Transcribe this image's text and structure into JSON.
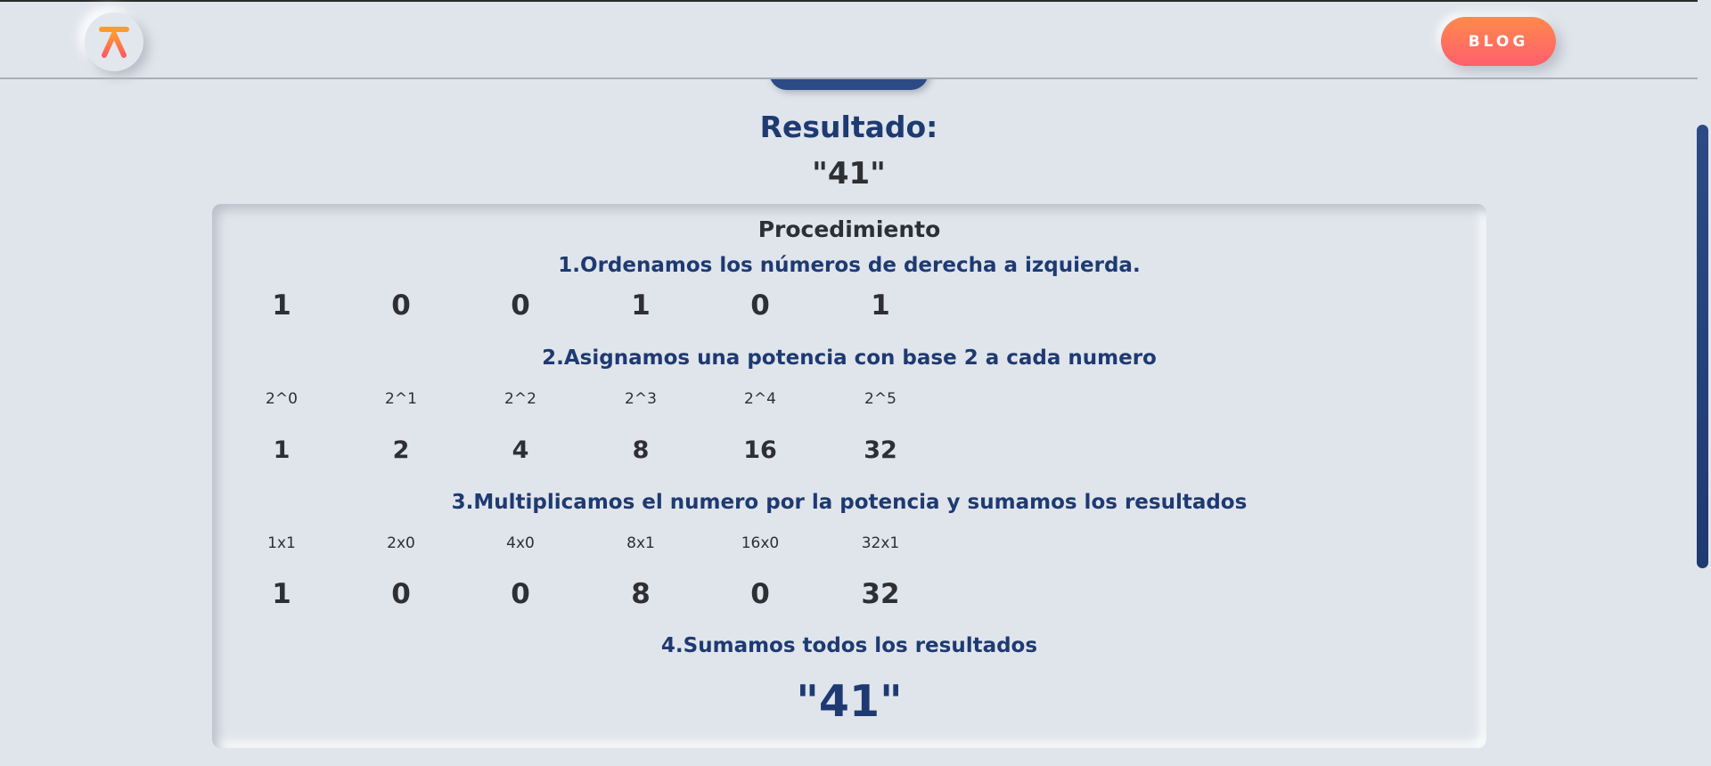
{
  "header": {
    "logo_icon": "caret-logo-icon",
    "blog_label": "BLOG"
  },
  "result": {
    "title": "Resultado:",
    "value": "\"41\""
  },
  "procedure": {
    "title": "Procedimiento",
    "step1": {
      "title": "1.Ordenamos los números de derecha a izquierda.",
      "digits": [
        "1",
        "0",
        "0",
        "1",
        "0",
        "1"
      ]
    },
    "step2": {
      "title": "2.Asignamos una potencia con base 2 a cada numero",
      "powers": [
        "2^0",
        "2^1",
        "2^2",
        "2^3",
        "2^4",
        "2^5"
      ],
      "values": [
        "1",
        "2",
        "4",
        "8",
        "16",
        "32"
      ]
    },
    "step3": {
      "title": "3.Multiplicamos el numero por la potencia y sumamos los resultados",
      "products": [
        "1x1",
        "2x0",
        "4x0",
        "8x1",
        "16x0",
        "32x1"
      ],
      "values": [
        "1",
        "0",
        "0",
        "8",
        "0",
        "32"
      ]
    },
    "step4": {
      "title": "4.Sumamos todos los resultados",
      "total": "\"41\""
    }
  },
  "colors": {
    "background": "#e0e5ec",
    "accent": "#1e3a72",
    "blog_gradient_start": "#ff8a4c",
    "blog_gradient_end": "#ff5f6d"
  }
}
